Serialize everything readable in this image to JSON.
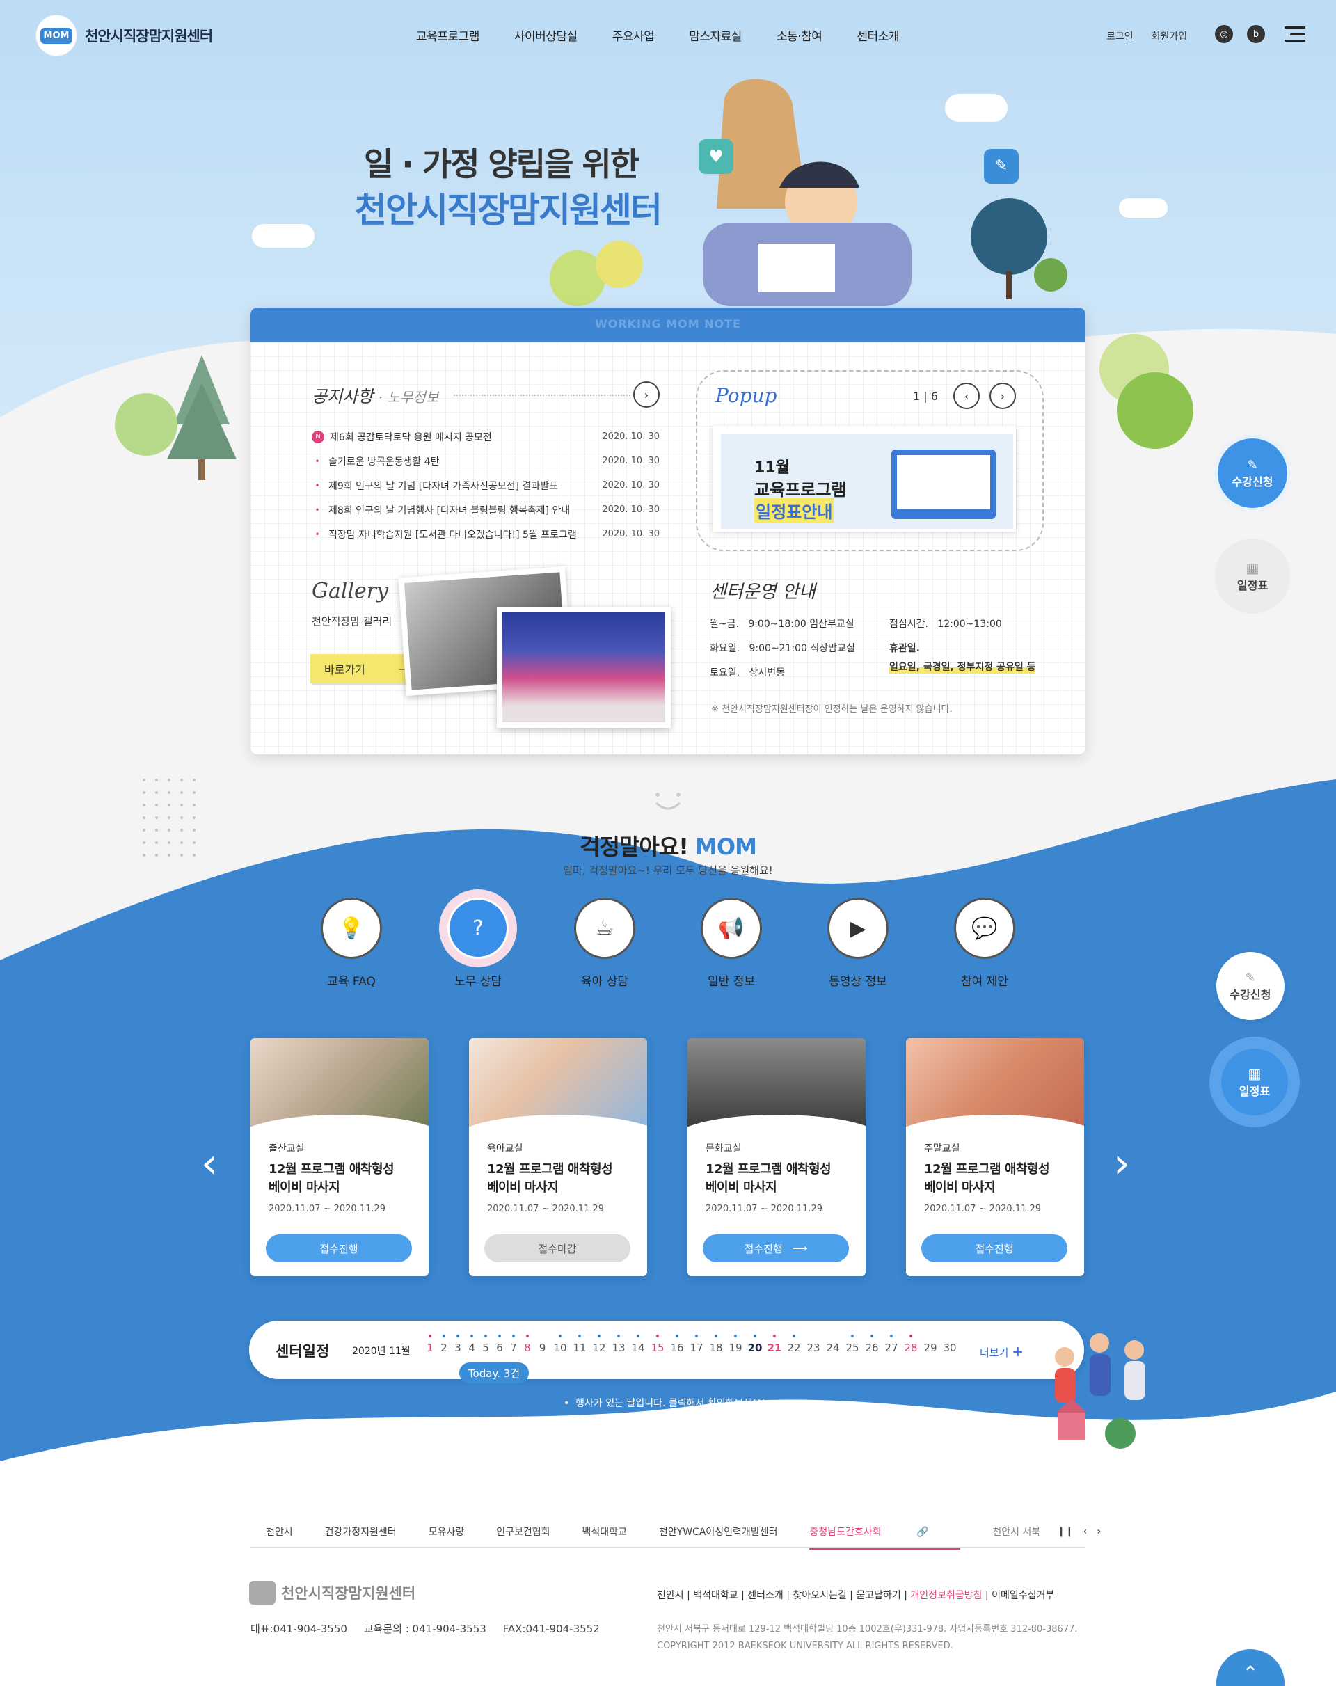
{
  "header": {
    "logo_mark": "MOM",
    "logo_text": "천안시직장맘지원센터",
    "nav": [
      "교육프로그램",
      "사이버상담실",
      "주요사업",
      "맘스자료실",
      "소통·참여",
      "센터소개"
    ],
    "login": "로그인",
    "join": "회원가입"
  },
  "hero": {
    "line1": "일 · 가정 양립을 위한",
    "line2": "천안시직장맘지원센터"
  },
  "board": {
    "banner": "WORKING MOM NOTE",
    "notice_title": "공지사항",
    "notice_sub": "· 노무정보",
    "notices": [
      {
        "title": "제6회 공감토닥토닥 응원 메시지 공모전",
        "date": "2020. 10. 30",
        "new": "N"
      },
      {
        "title": "슬기로운 방콕운동생활 4탄",
        "date": "2020. 10. 30"
      },
      {
        "title": "제9회 인구의 날 기념 [다자녀 가족사진공모전] 결과발표",
        "date": "2020. 10. 30"
      },
      {
        "title": "제8회 인구의 날 기념행사 [다자녀 블링블링 행복축제] 안내",
        "date": "2020. 10. 30"
      },
      {
        "title": "직장맘 자녀학습지원 [도서관 다녀오겠습니다!] 5월 프로그램",
        "date": "2020. 10. 30"
      }
    ],
    "popup_title": "Popup",
    "popup_count": "1 | 6",
    "popup_banner": {
      "line1": "11월",
      "line2": "교육프로그램",
      "line3": "일정표안내"
    },
    "gallery_title": "Gallery",
    "gallery_sub": "천안직장맘 갤러리",
    "gallery_btn": "바로가기",
    "ops_title": "센터운영 안내",
    "ops": {
      "r1_day": "월~금.",
      "r1_time": "9:00~18:00 임산부교실",
      "r2_day": "화요일.",
      "r2_time": "9:00~21:00 직장맘교실",
      "r3_day": "토요일.",
      "r3_time": "상시변동",
      "lunch_label": "점심시간.",
      "lunch_time": "12:00~13:00",
      "closed_label": "휴관일.",
      "closed_days": "일요일, 국경일, 정부지정 공유일 등"
    },
    "ops_note": "※ 천안시직장맘지원센터장이 인정하는 날은 운영하지 않습니다."
  },
  "worry": {
    "title_kr": "걱정말아요!",
    "title_en": "MOM",
    "subtitle": "엄마, 걱정말아요~! 우리 모두 당신을 응원해요!",
    "services": [
      {
        "label": "교육 FAQ",
        "icon": "lightbulb-icon"
      },
      {
        "label": "노무 상담",
        "icon": "chat-question-icon"
      },
      {
        "label": "육아 상담",
        "icon": "cup-icon"
      },
      {
        "label": "일반 정보",
        "icon": "megaphone-icon"
      },
      {
        "label": "동영상 정보",
        "icon": "video-icon"
      },
      {
        "label": "참여 제안",
        "icon": "speech-icon"
      }
    ]
  },
  "programs": [
    {
      "category": "출산교실",
      "title1": "12월 프로그램 애착형성",
      "title2": "베이비 마사지",
      "date": "2020.11.07 ~ 2020.11.29",
      "button": "접수진행"
    },
    {
      "category": "육아교실",
      "title1": "12월 프로그램 애착형성",
      "title2": "베이비 마사지",
      "date": "2020.11.07 ~ 2020.11.29",
      "button": "접수마감"
    },
    {
      "category": "문화교실",
      "title1": "12월 프로그램 애착형성",
      "title2": "베이비 마사지",
      "date": "2020.11.07 ~ 2020.11.29",
      "button": "접수진행"
    },
    {
      "category": "주말교실",
      "title1": "12월 프로그램 애착형성",
      "title2": "베이비 마사지",
      "date": "2020.11.07 ~ 2020.11.29",
      "button": "접수진행"
    }
  ],
  "calendar": {
    "title": "센터일정",
    "month": "2020년 11월",
    "days": [
      "1",
      "2",
      "3",
      "4",
      "5",
      "6",
      "7",
      "8",
      "9",
      "10",
      "11",
      "12",
      "13",
      "14",
      "15",
      "16",
      "17",
      "18",
      "19",
      "20",
      "21",
      "22",
      "23",
      "24",
      "25",
      "26",
      "27",
      "28",
      "29",
      "30"
    ],
    "more": "더보기",
    "today": "Today. 3건",
    "note": "행사가 있는 날입니다. 클릭해서 확인해보세요!"
  },
  "side": {
    "apply": "수강신청",
    "schedule": "일정표"
  },
  "footer": {
    "family_sites": [
      "천안시",
      "건강가정지원센터",
      "모유사랑",
      "인구보건협회",
      "백석대학교",
      "천안YWCA여성인력개발센터",
      "충청남도간호사회",
      "천안시 서북"
    ],
    "logo_text": "천안시직장맘지원센터",
    "contact": "대표:041-904-3550     교육문의 : 041-904-3553     FAX:041-904-3552",
    "links": [
      "천안시",
      "백석대학교",
      "센터소개",
      "찾아오시는길",
      "묻고답하기",
      "개인정보취급방침",
      "이메일수집거부"
    ],
    "address": "천안시 서북구 동서대로 129-12 백석대학빌딩 10층 1002호(우)331-978.  사업자등록번호 312-80-38677.",
    "copyright": "COPYRIGHT 2012 BAEKSEOK UNIVERSITY ALL RIGHTS RESERVED."
  },
  "colors": {
    "brand_blue": "#3b86cf",
    "accent_pink": "#e0407a",
    "highlight_yellow": "#f5e66c"
  }
}
